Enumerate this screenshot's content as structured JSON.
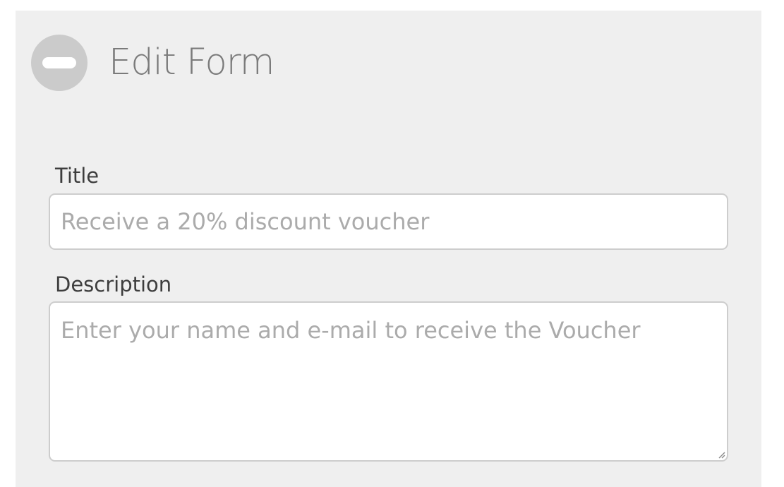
{
  "header": {
    "title": "Edit Form",
    "collapse_icon": "minus-circle-icon"
  },
  "form": {
    "title_field": {
      "label": "Title",
      "value": "",
      "placeholder": "Receive a 20% discount voucher"
    },
    "description_field": {
      "label": "Description",
      "value": "",
      "placeholder": "Enter your name and e-mail to receive the Voucher"
    }
  },
  "colors": {
    "panel_background": "#efefef",
    "icon_circle": "#cbcbcb",
    "title_text": "#7a7a7a",
    "label_text": "#3d3d3d",
    "placeholder_text": "#ababab",
    "input_border": "#cdcdcd"
  }
}
